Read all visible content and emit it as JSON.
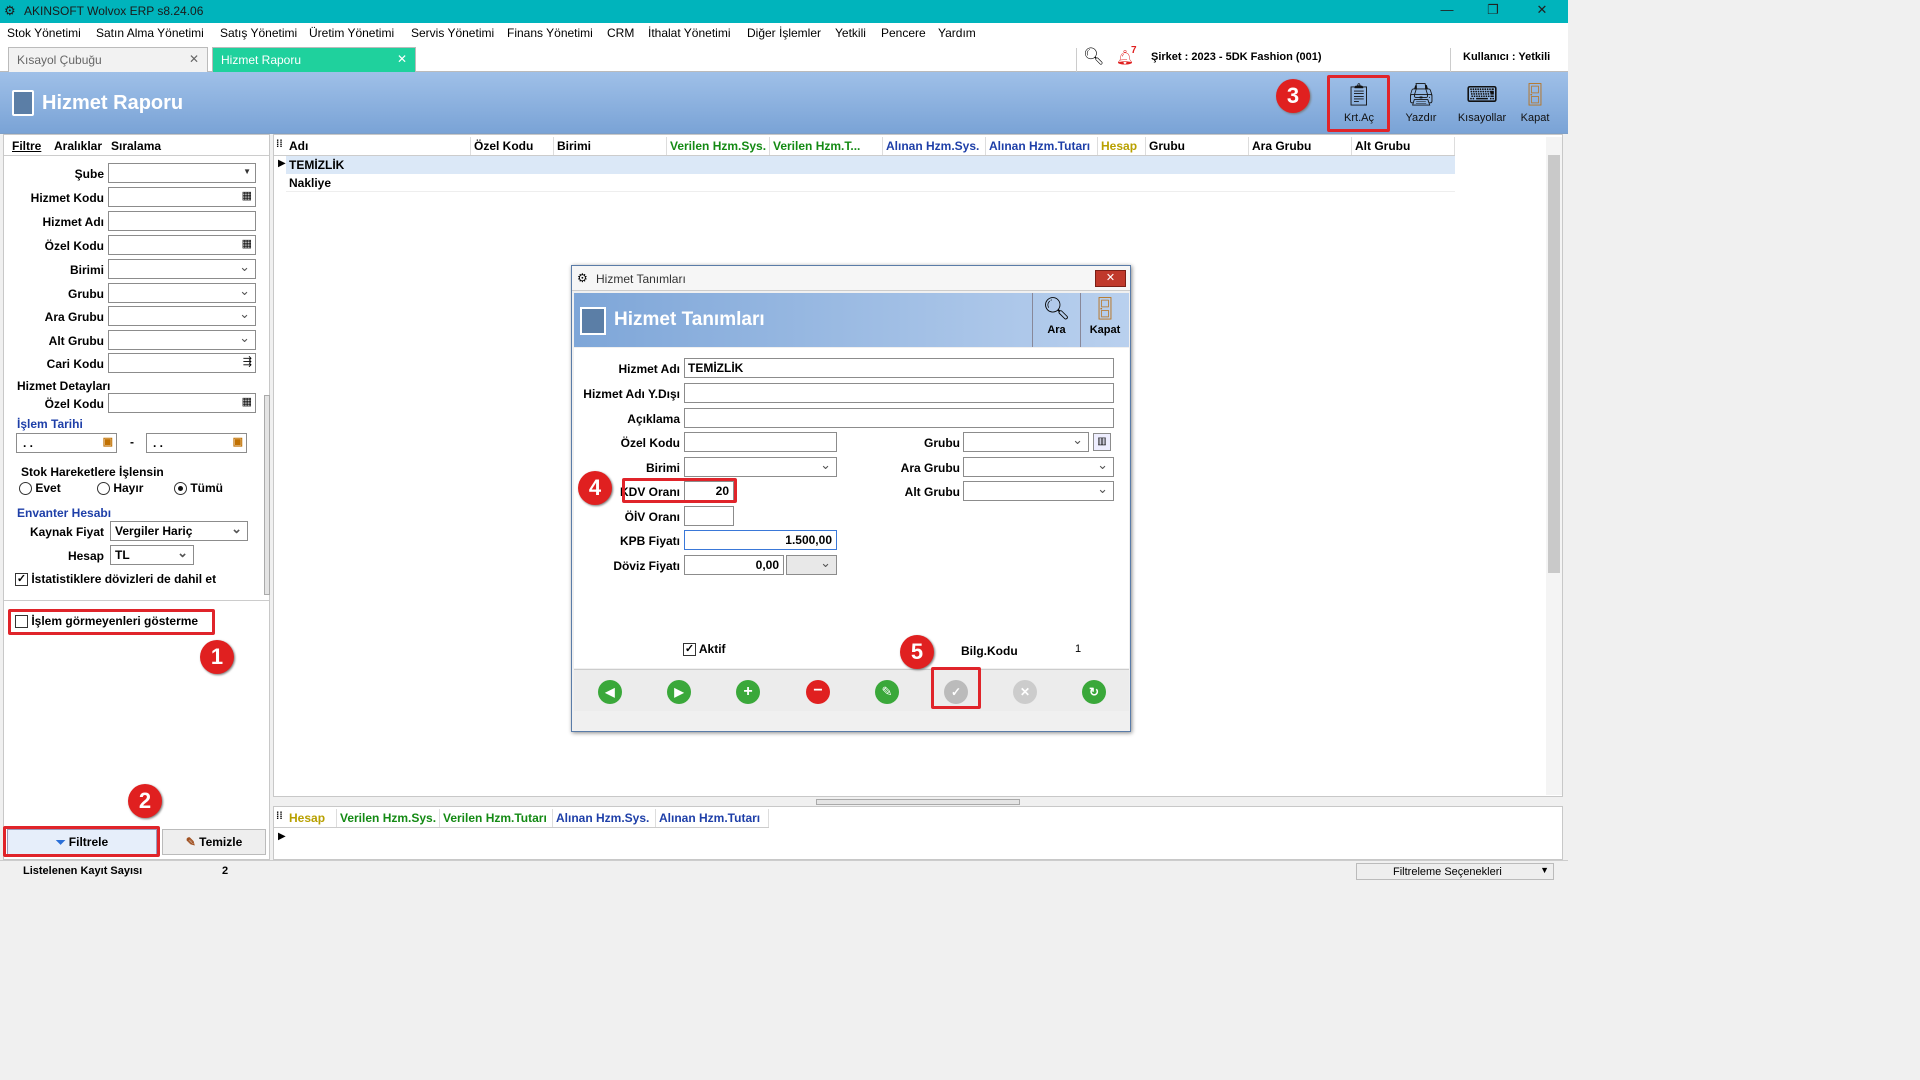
{
  "app": {
    "title": "AKINSOFT Wolvox ERP s8.24.06"
  },
  "menu": [
    "Stok Yönetimi",
    "Satın Alma Yönetimi",
    "Satış Yönetimi",
    "Üretim Yönetimi",
    "Servis Yönetimi",
    "Finans Yönetimi",
    "CRM",
    "İthalat Yönetimi",
    "Diğer İşlemler",
    "Yetkili",
    "Pencere",
    "Yardım"
  ],
  "tabs": [
    {
      "label": "Kısayol Çubuğu"
    },
    {
      "label": "Hizmet Raporu"
    }
  ],
  "topinfo": {
    "notif_count": "7",
    "company": "Şirket : 2023 - 5DK Fashion (001)",
    "user": "Kullanıcı : Yetkili"
  },
  "header": {
    "title": "Hizmet Raporu"
  },
  "toolbar": {
    "open": "Krt.Aç",
    "print": "Yazdır",
    "shortcuts": "Kısayollar",
    "close": "Kapat"
  },
  "left": {
    "tabs": [
      "Filtre",
      "Aralıklar",
      "Sıralama"
    ],
    "fields": {
      "sube": "Şube",
      "hizmet_kodu": "Hizmet Kodu",
      "hizmet_adi": "Hizmet Adı",
      "ozel_kodu": "Özel Kodu",
      "birimi": "Birimi",
      "grubu": "Grubu",
      "ara_grubu": "Ara Grubu",
      "alt_grubu": "Alt Grubu",
      "cari_kodu": "Cari Kodu"
    },
    "details_title": "Hizmet Detayları",
    "details_ozel_kodu": "Özel Kodu",
    "date_title": "İşlem Tarihi",
    "date_from": ". .",
    "date_to": ". .",
    "date_sep": "-",
    "stock_title": "Stok Hareketlere İşlensin",
    "stock_options": [
      "Evet",
      "Hayır",
      "Tümü"
    ],
    "inventory_title": "Envanter Hesabı",
    "source_price_label": "Kaynak Fiyat",
    "source_price_value": "Vergiler Hariç",
    "account_label": "Hesap",
    "account_value": "TL",
    "stats_checkbox": "İstatistiklere dövizleri de dahil et",
    "hide_unused_checkbox": "İşlem görmeyenleri gösterme",
    "filter_button": "Filtrele",
    "clear_button": "Temizle"
  },
  "grid": {
    "columns": [
      "Adı",
      "Özel Kodu",
      "Birimi",
      "Verilen Hzm.Sys.",
      "Verilen Hzm.T...",
      "Alınan Hzm.Sys.",
      "Alınan Hzm.Tutarı",
      "Hesap",
      "Grubu",
      "Ara Grubu",
      "Alt Grubu"
    ],
    "rows": [
      [
        "TEMİZLİK"
      ],
      [
        "Nakliye"
      ]
    ]
  },
  "bottomgrid": {
    "columns": [
      "Hesap",
      "Verilen Hzm.Sys.",
      "Verilen Hzm.Tutarı",
      "Alınan Hzm.Sys.",
      "Alınan Hzm.Tutarı"
    ]
  },
  "status": {
    "count_label": "Listelenen Kayıt Sayısı",
    "count_value": "2",
    "filter_options": "Filtreleme Seçenekleri"
  },
  "dialog": {
    "window_title": "Hizmet Tanımları",
    "title": "Hizmet Tanımları",
    "search": "Ara",
    "close": "Kapat",
    "labels": {
      "hizmet_adi": "Hizmet Adı",
      "hizmet_adi_ydisi": "Hizmet Adı Y.Dışı",
      "aciklama": "Açıklama",
      "ozel_kodu": "Özel Kodu",
      "birimi": "Birimi",
      "kdv": "KDV Oranı",
      "oiv": "ÖİV Oranı",
      "kpb": "KPB Fiyatı",
      "doviz": "Döviz Fiyatı",
      "grubu": "Grubu",
      "ara_grubu": "Ara Grubu",
      "alt_grubu": "Alt Grubu",
      "aktif": "Aktif",
      "bilg_kodu": "Bilg.Kodu"
    },
    "values": {
      "hizmet_adi": "TEMİZLİK",
      "kdv": "20",
      "kpb": "1.500,00",
      "doviz": "0,00",
      "bilg_kodu": "1"
    }
  },
  "annotations": [
    "1",
    "2",
    "3",
    "4",
    "5"
  ]
}
